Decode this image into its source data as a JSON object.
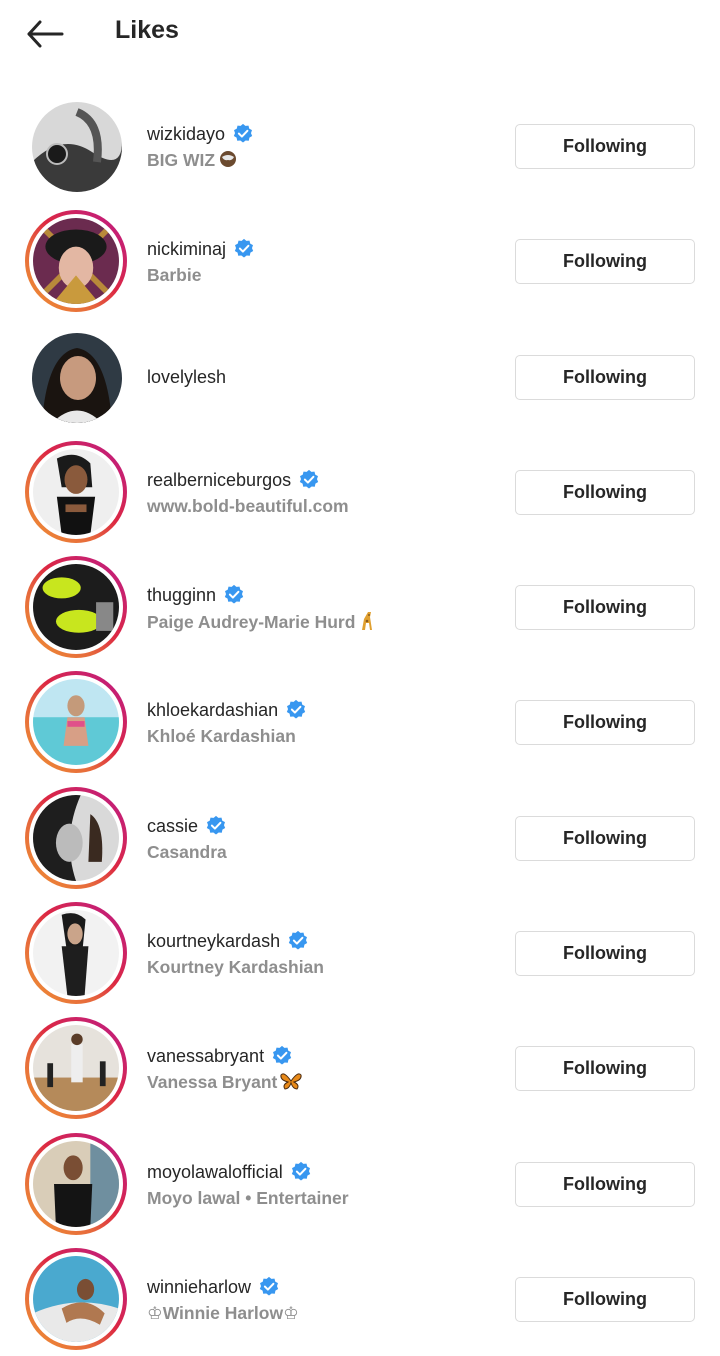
{
  "header": {
    "title": "Likes",
    "back_icon": "arrow-left-icon"
  },
  "colors": {
    "verified": "#3897f0",
    "button_border": "#dbdbdb",
    "secondary_text": "#8e8e8e",
    "story_ring": [
      "#f09433",
      "#dc2743",
      "#bc1888"
    ]
  },
  "users": [
    {
      "username": "wizkidayo",
      "fullname": "BIG WIZ",
      "verified": true,
      "story_ring": false,
      "button": "Following"
    },
    {
      "username": "nickiminaj",
      "fullname": "Barbie",
      "verified": true,
      "story_ring": true,
      "button": "Following"
    },
    {
      "username": "lovelylesh",
      "fullname": "",
      "verified": false,
      "story_ring": false,
      "button": "Following"
    },
    {
      "username": "realberniceburgos",
      "fullname": "www.bold-beautiful.com",
      "verified": true,
      "story_ring": true,
      "button": "Following"
    },
    {
      "username": "thugginn",
      "fullname": "Paige Audrey-Marie Hurd",
      "verified": true,
      "story_ring": true,
      "button": "Following"
    },
    {
      "username": "khloekardashian",
      "fullname": "Khloé Kardashian",
      "verified": true,
      "story_ring": true,
      "button": "Following"
    },
    {
      "username": "cassie",
      "fullname": "Casandra",
      "verified": true,
      "story_ring": true,
      "button": "Following"
    },
    {
      "username": "kourtneykardash",
      "fullname": "Kourtney Kardashian",
      "verified": true,
      "story_ring": true,
      "button": "Following"
    },
    {
      "username": "vanessabryant",
      "fullname": "Vanessa Bryant",
      "verified": true,
      "story_ring": true,
      "button": "Following"
    },
    {
      "username": "moyolawalofficial",
      "fullname": "Moyo lawal • Entertainer",
      "verified": true,
      "story_ring": true,
      "button": "Following"
    },
    {
      "username": "winnieharlow",
      "fullname": "♔Winnie Harlow♔",
      "verified": true,
      "story_ring": true,
      "button": "Following"
    }
  ]
}
